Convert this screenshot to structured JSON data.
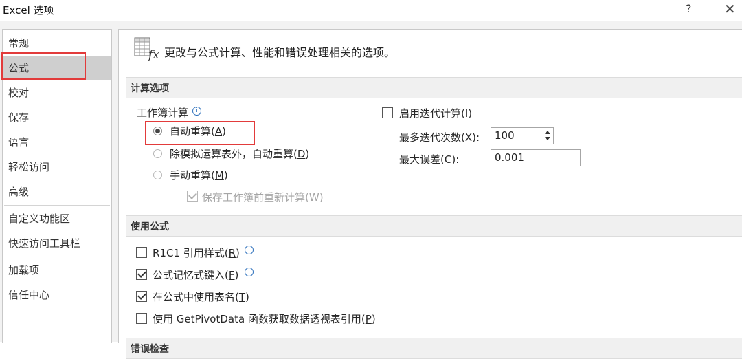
{
  "window": {
    "title": "Excel 选项",
    "help_label": "?",
    "close_label": "✕"
  },
  "sidebar": {
    "items": [
      {
        "label": "常规"
      },
      {
        "label": "公式"
      },
      {
        "label": "校对"
      },
      {
        "label": "保存"
      },
      {
        "label": "语言"
      },
      {
        "label": "轻松访问"
      },
      {
        "label": "高级"
      },
      {
        "label": "自定义功能区"
      },
      {
        "label": "快速访问工具栏"
      },
      {
        "label": "加载项"
      },
      {
        "label": "信任中心"
      }
    ],
    "selected": "公式"
  },
  "main": {
    "header_text": "更改与公式计算、性能和错误处理相关的选项。",
    "icon": "formula-fx-icon",
    "calc_section": {
      "title": "计算选项",
      "workbook_calc_label": "工作簿计算",
      "auto_label": "自动重算(",
      "auto_key": "A",
      "auto_end": ")",
      "auto_except_label": "除模拟运算表外，自动重算(",
      "auto_except_key": "D",
      "auto_except_end": ")",
      "manual_label": "手动重算(",
      "manual_key": "M",
      "manual_end": ")",
      "recalc_before_save_label": "保存工作簿前重新计算(",
      "recalc_before_save_key": "W",
      "recalc_before_save_end": ")",
      "iterative_label": "启用迭代计算(",
      "iterative_key": "I",
      "iterative_end": ")",
      "max_iter_label": "最多迭代次数(",
      "max_iter_key": "X",
      "max_iter_end": "):",
      "max_iter_value": "100",
      "max_change_label": "最大误差(",
      "max_change_key": "C",
      "max_change_end": "):",
      "max_change_value": "0.001",
      "selected_mode": "auto",
      "iterative_enabled": false,
      "recalc_before_save_checked": true
    },
    "formulas_section": {
      "title": "使用公式",
      "r1c1_label": "R1C1 引用样式(",
      "r1c1_key": "R",
      "r1c1_end": ")",
      "autocomplete_label": "公式记忆式键入(",
      "autocomplete_key": "F",
      "autocomplete_end": ")",
      "table_names_label": "在公式中使用表名(",
      "table_names_key": "T",
      "table_names_end": ")",
      "getpivot_label": "使用 GetPivotData 函数获取数据透视表引用(",
      "getpivot_key": "P",
      "getpivot_end": ")",
      "r1c1_checked": false,
      "autocomplete_checked": true,
      "table_names_checked": true,
      "getpivot_checked": false
    },
    "next_section_title": "错误检查"
  },
  "colors": {
    "highlight_red": "#e23b3b",
    "selected_bg": "#cfcfcf",
    "info_blue": "#2a6ebb"
  }
}
